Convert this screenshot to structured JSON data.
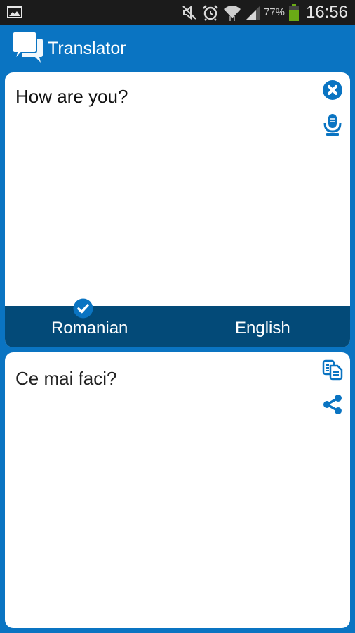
{
  "status_bar": {
    "icons": [
      "gallery-icon",
      "mute-icon",
      "alarm-icon",
      "wifi-icon",
      "signal-icon",
      "battery-icon"
    ],
    "battery_percent": "77%",
    "time": "16:56"
  },
  "app_bar": {
    "title": "Translator",
    "logo_icon": "chat-bubbles-icon"
  },
  "input_card": {
    "text": "How are you?",
    "actions": [
      {
        "name": "clear",
        "icon": "close-circle-icon"
      },
      {
        "name": "voice-input",
        "icon": "microphone-icon"
      }
    ]
  },
  "language_bar": {
    "source_language": "Romanian",
    "target_language": "English",
    "selected": "Romanian"
  },
  "output_card": {
    "text": "Ce mai faci?",
    "actions": [
      {
        "name": "copy",
        "icon": "copy-icon"
      },
      {
        "name": "share",
        "icon": "share-icon"
      }
    ]
  },
  "colors": {
    "brand_blue": "#0a74c2",
    "lang_bar": "#034a78",
    "status_bar": "#1b1b1b",
    "battery_green": "#6aaa16"
  }
}
